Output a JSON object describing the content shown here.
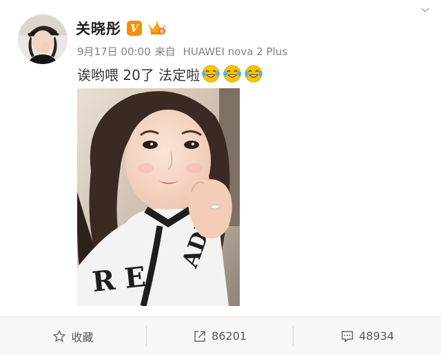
{
  "author": {
    "name": "关晓彤",
    "verified_mark": "V",
    "badge_icon": "vip-crown-icon",
    "avatar_icon": "avatar-photo"
  },
  "meta": {
    "time": "9月17日 00:00",
    "source_prefix": "来自",
    "device": "HUAWEI nova 2 Plus"
  },
  "post": {
    "text": "诶哟喂 20了 法定啦",
    "emojis": [
      "laugh-cry-emoji",
      "laugh-cry-emoji",
      "laugh-cry-emoji"
    ],
    "photo_icon": "selfie-photo"
  },
  "actions": {
    "favorite": {
      "icon": "star-icon",
      "label": "收藏"
    },
    "repost": {
      "icon": "share-icon",
      "label": "86201"
    },
    "comment": {
      "icon": "comment-icon",
      "label": "48934"
    }
  },
  "colors": {
    "accent": "#f29100",
    "action_bar_bg": "#f7f7f7",
    "meta_text": "#808080"
  }
}
